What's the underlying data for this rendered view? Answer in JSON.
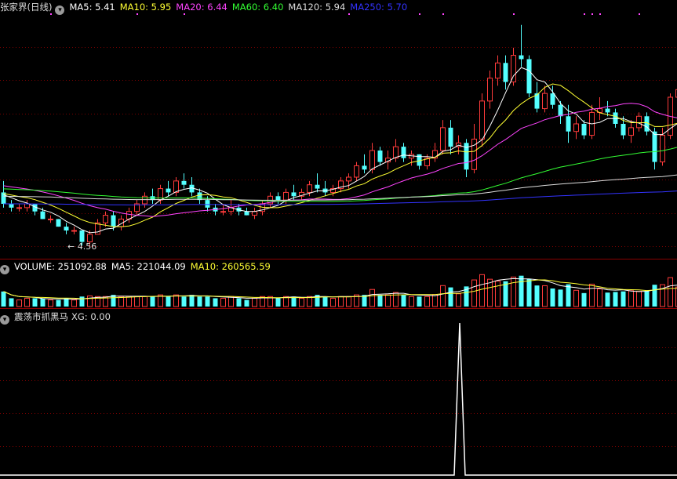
{
  "main_panel": {
    "title": "张家界(日线)",
    "ma_legend": [
      {
        "label": "MA5: 5.41",
        "color": "#ffffff"
      },
      {
        "label": "MA10: 5.95",
        "color": "#ffff33"
      },
      {
        "label": "MA20: 6.44",
        "color": "#ff44ff"
      },
      {
        "label": "MA60: 6.40",
        "color": "#33ff33"
      },
      {
        "label": "MA120: 5.94",
        "color": "#dddddd"
      },
      {
        "label": "MA250: 5.70",
        "color": "#3333ff"
      }
    ],
    "low_marker": "4.56"
  },
  "volume_panel": {
    "legend": [
      {
        "label": "VOLUME: 251092.88",
        "color": "#ffffff"
      },
      {
        "label": "MA5: 221044.09",
        "color": "#ffffff"
      },
      {
        "label": "MA10: 260565.59",
        "color": "#ffff33"
      }
    ]
  },
  "indicator_panel": {
    "title": "震荡市抓黑马",
    "value_label": "XG: 0.00"
  },
  "colors": {
    "up": "#ff3b3b",
    "down": "#54ffff",
    "grid": "#7a0000",
    "divider": "#8a0000",
    "ma5": "#ffffff",
    "ma10": "#ffff33",
    "ma20": "#ff44ff",
    "ma60": "#33ff33",
    "ma120": "#dddddd",
    "ma250": "#3333ff",
    "signal_dot": "#ff44ff",
    "xg": "#ffffff"
  },
  "chart_data": {
    "type": "candlestick",
    "price_range": [
      4.3,
      10.6
    ],
    "candles": [
      [
        6.0,
        6.3,
        5.6,
        5.7
      ],
      [
        5.7,
        5.8,
        5.5,
        5.6
      ],
      [
        5.6,
        5.7,
        5.5,
        5.6
      ],
      [
        5.6,
        5.8,
        5.5,
        5.7
      ],
      [
        5.7,
        5.7,
        5.4,
        5.5
      ],
      [
        5.5,
        5.6,
        5.3,
        5.3
      ],
      [
        5.3,
        5.4,
        5.2,
        5.3
      ],
      [
        5.3,
        5.3,
        5.1,
        5.1
      ],
      [
        5.1,
        5.2,
        4.9,
        5.0
      ],
      [
        5.0,
        5.1,
        4.9,
        5.0
      ],
      [
        5.0,
        5.0,
        4.6,
        4.7
      ],
      [
        4.7,
        5.0,
        4.56,
        4.9
      ],
      [
        4.9,
        5.3,
        4.9,
        5.2
      ],
      [
        5.2,
        5.5,
        5.1,
        5.4
      ],
      [
        5.4,
        5.5,
        5.0,
        5.1
      ],
      [
        5.1,
        5.4,
        5.0,
        5.3
      ],
      [
        5.3,
        5.6,
        5.2,
        5.5
      ],
      [
        5.5,
        5.8,
        5.4,
        5.7
      ],
      [
        5.7,
        6.0,
        5.6,
        5.9
      ],
      [
        5.9,
        6.1,
        5.7,
        5.8
      ],
      [
        5.8,
        6.2,
        5.7,
        6.1
      ],
      [
        6.1,
        6.3,
        5.9,
        6.0
      ],
      [
        6.0,
        6.4,
        5.9,
        6.3
      ],
      [
        6.3,
        6.5,
        6.1,
        6.2
      ],
      [
        6.2,
        6.4,
        5.9,
        6.0
      ],
      [
        6.0,
        6.1,
        5.7,
        5.8
      ],
      [
        5.8,
        5.9,
        5.5,
        5.6
      ],
      [
        5.6,
        5.7,
        5.4,
        5.5
      ],
      [
        5.5,
        5.7,
        5.4,
        5.5
      ],
      [
        5.5,
        5.8,
        5.4,
        5.6
      ],
      [
        5.6,
        5.7,
        5.4,
        5.5
      ],
      [
        5.5,
        5.6,
        5.4,
        5.4
      ],
      [
        5.4,
        5.6,
        5.3,
        5.5
      ],
      [
        5.5,
        5.8,
        5.4,
        5.7
      ],
      [
        5.7,
        6.0,
        5.6,
        5.9
      ],
      [
        5.9,
        6.0,
        5.7,
        5.8
      ],
      [
        5.8,
        6.1,
        5.7,
        6.0
      ],
      [
        6.0,
        6.2,
        5.8,
        5.9
      ],
      [
        5.9,
        6.1,
        5.8,
        6.0
      ],
      [
        6.0,
        6.3,
        5.9,
        6.2
      ],
      [
        6.2,
        6.5,
        6.0,
        6.1
      ],
      [
        6.1,
        6.3,
        5.9,
        6.0
      ],
      [
        6.0,
        6.2,
        5.9,
        6.1
      ],
      [
        6.1,
        6.4,
        6.0,
        6.3
      ],
      [
        6.3,
        6.5,
        6.1,
        6.4
      ],
      [
        6.4,
        6.8,
        6.3,
        6.7
      ],
      [
        6.7,
        7.0,
        6.5,
        6.6
      ],
      [
        6.6,
        7.3,
        6.5,
        7.1
      ],
      [
        7.1,
        7.2,
        6.7,
        6.8
      ],
      [
        6.8,
        7.1,
        6.6,
        6.9
      ],
      [
        6.9,
        7.4,
        6.8,
        7.2
      ],
      [
        7.2,
        7.3,
        6.8,
        6.9
      ],
      [
        6.9,
        7.1,
        6.7,
        7.0
      ],
      [
        7.0,
        7.0,
        6.6,
        6.7
      ],
      [
        6.7,
        7.0,
        6.6,
        6.9
      ],
      [
        6.9,
        7.3,
        6.8,
        7.1
      ],
      [
        7.1,
        7.9,
        7.0,
        7.7
      ],
      [
        7.7,
        7.9,
        7.0,
        7.2
      ],
      [
        7.2,
        7.5,
        7.0,
        7.3
      ],
      [
        7.3,
        7.4,
        6.4,
        6.6
      ],
      [
        6.6,
        7.8,
        6.5,
        7.4
      ],
      [
        7.4,
        8.6,
        7.2,
        8.4
      ],
      [
        8.4,
        9.2,
        8.2,
        9.0
      ],
      [
        9.0,
        9.6,
        8.8,
        9.4
      ],
      [
        9.4,
        9.6,
        8.7,
        8.9
      ],
      [
        8.9,
        9.8,
        8.8,
        9.6
      ],
      [
        9.6,
        10.4,
        9.3,
        9.5
      ],
      [
        9.5,
        9.6,
        8.5,
        8.6
      ],
      [
        8.6,
        8.9,
        8.1,
        8.2
      ],
      [
        8.2,
        8.8,
        8.1,
        8.6
      ],
      [
        8.6,
        8.8,
        8.2,
        8.3
      ],
      [
        8.3,
        8.4,
        7.8,
        8.0
      ],
      [
        8.0,
        8.3,
        7.3,
        7.6
      ],
      [
        7.6,
        8.0,
        7.4,
        7.8
      ],
      [
        7.8,
        7.9,
        7.4,
        7.5
      ],
      [
        7.5,
        8.3,
        7.4,
        8.1
      ],
      [
        8.1,
        8.5,
        7.9,
        8.2
      ],
      [
        8.2,
        8.4,
        8.0,
        8.1
      ],
      [
        8.1,
        8.2,
        7.7,
        7.8
      ],
      [
        7.8,
        8.0,
        7.4,
        7.5
      ],
      [
        7.5,
        7.9,
        7.3,
        7.7
      ],
      [
        7.7,
        8.1,
        7.6,
        8.0
      ],
      [
        8.0,
        8.1,
        7.5,
        7.6
      ],
      [
        7.6,
        7.7,
        6.6,
        6.8
      ],
      [
        6.8,
        7.7,
        6.7,
        7.5
      ],
      [
        7.5,
        8.6,
        7.4,
        8.5
      ],
      [
        8.5,
        8.9,
        8.3,
        8.7
      ],
      [
        8.7,
        8.9,
        8.4,
        8.6
      ]
    ],
    "volume_range": [
      0,
      800000
    ],
    "xg_range": [
      0,
      1
    ],
    "xg_signal_index": 60
  }
}
